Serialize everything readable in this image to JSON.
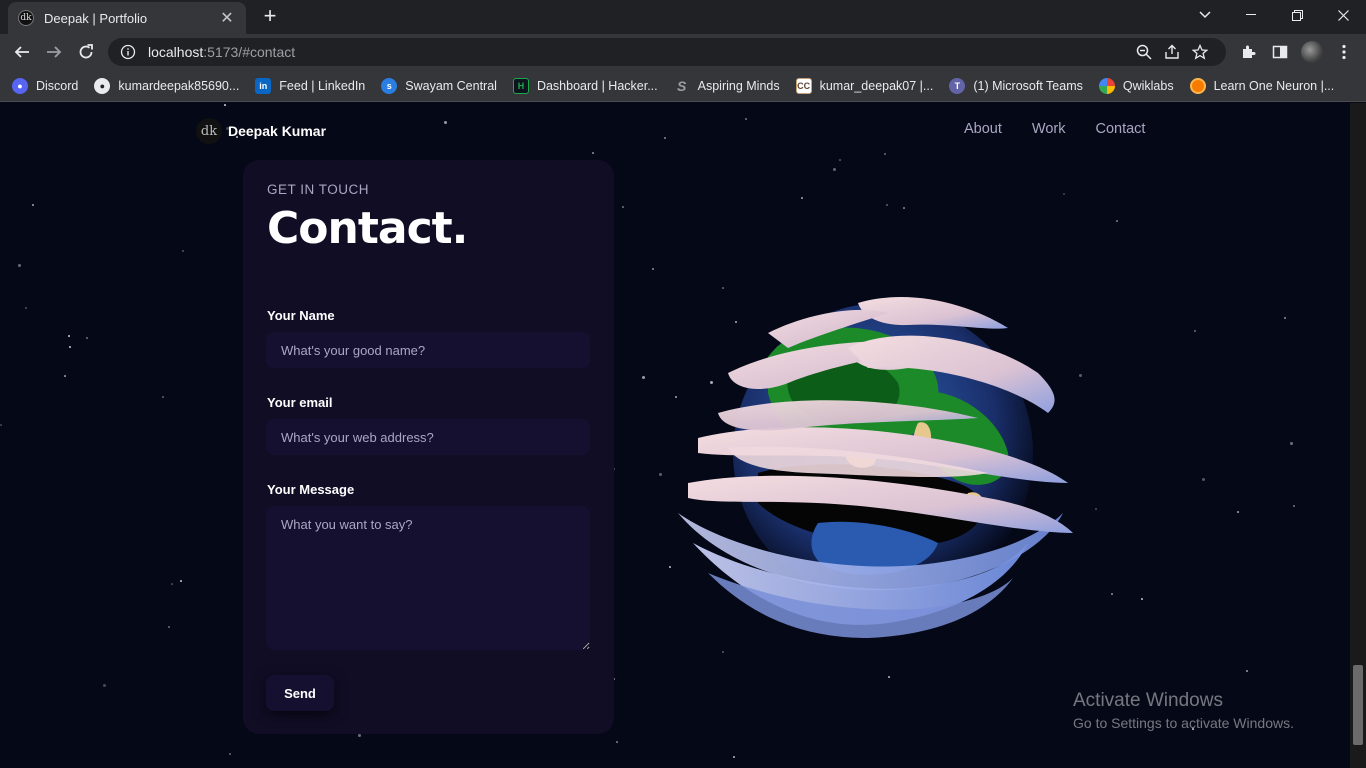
{
  "browser": {
    "tab_title": "Deepak | Portfolio",
    "tab_favicon": "dk",
    "url_host": "localhost",
    "url_rest": ":5173/#contact",
    "bookmarks": [
      {
        "label": "Discord",
        "icon": "discord-icon",
        "color": "#5865f2"
      },
      {
        "label": "kumardeepak85690...",
        "icon": "github-icon",
        "color": "#e8eaed"
      },
      {
        "label": "Feed | LinkedIn",
        "icon": "linkedin-icon",
        "color": "#0a66c2"
      },
      {
        "label": "Swayam Central",
        "icon": "swayam-icon",
        "color": "#2a7de1"
      },
      {
        "label": "Dashboard | Hacker...",
        "icon": "hackerrank-icon",
        "color": "#1ba94c"
      },
      {
        "label": "Aspiring Minds",
        "icon": "aspiring-minds-icon",
        "color": "#9aa0a6"
      },
      {
        "label": "kumar_deepak07 |...",
        "icon": "codechef-icon",
        "color": "#c8a276"
      },
      {
        "label": "(1) Microsoft Teams",
        "icon": "teams-icon",
        "color": "#6264a7"
      },
      {
        "label": "Qwiklabs",
        "icon": "qwiklabs-icon",
        "color": "#f4b400"
      },
      {
        "label": "Learn One Neuron |...",
        "icon": "neuron-icon",
        "color": "#f57c00"
      }
    ]
  },
  "site": {
    "logo_mark": "dk",
    "logo_text": "Deepak Kumar",
    "nav": [
      "About",
      "Work",
      "Contact"
    ]
  },
  "contact": {
    "eyebrow": "Get in touch",
    "headline": "Contact.",
    "name_label": "Your Name",
    "name_placeholder": "What's your good name?",
    "email_label": "Your email",
    "email_placeholder": "What's your web address?",
    "message_label": "Your Message",
    "message_placeholder": "What you want to say?",
    "send_label": "Send"
  },
  "os_watermark": {
    "line1": "Activate Windows",
    "line2": "Go to Settings to activate Windows."
  },
  "colors": {
    "page_bg": "#050816",
    "card_bg": "#100d25",
    "input_bg": "#151030",
    "secondary_text": "#aaa6c3"
  }
}
